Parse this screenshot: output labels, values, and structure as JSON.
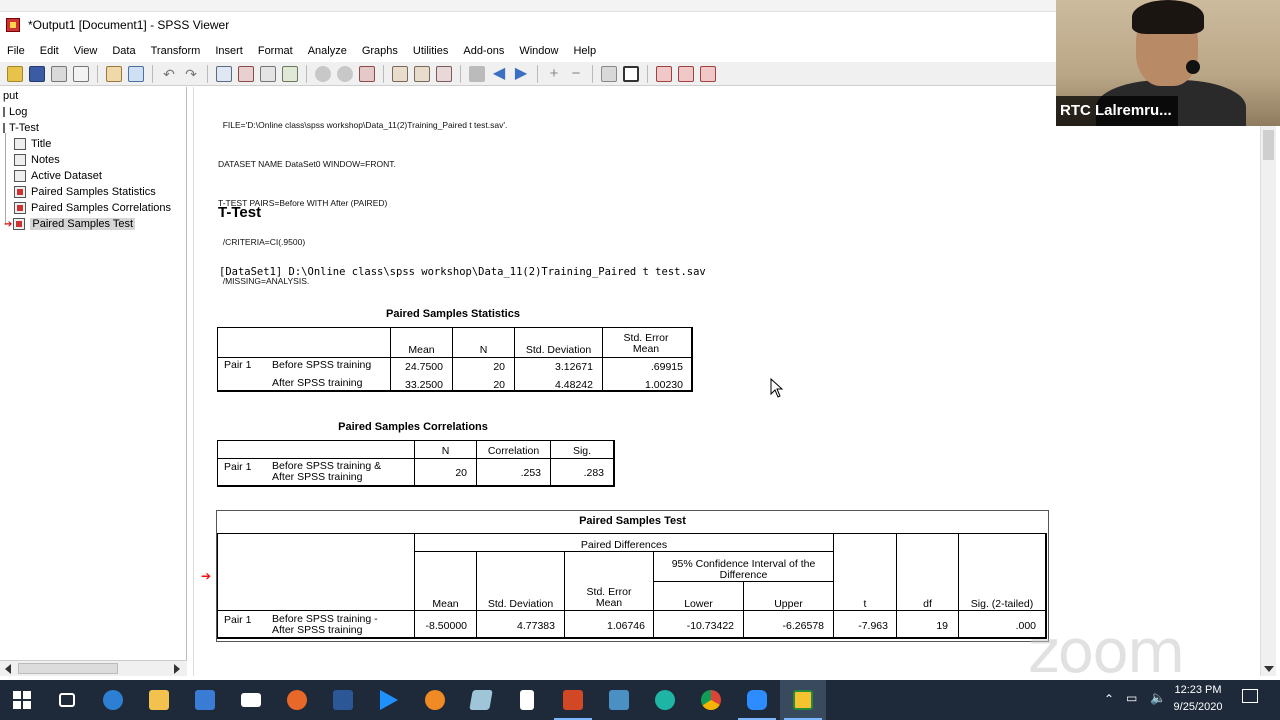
{
  "window": {
    "title": "*Output1 [Document1] - SPSS Viewer"
  },
  "menu": [
    "File",
    "Edit",
    "View",
    "Data",
    "Transform",
    "Insert",
    "Format",
    "Analyze",
    "Graphs",
    "Utilities",
    "Add-ons",
    "Window",
    "Help"
  ],
  "outline": {
    "root": "put",
    "log": "Log",
    "ttest": "T-Test",
    "children": [
      "Title",
      "Notes",
      "Active Dataset",
      "Paired Samples Statistics",
      "Paired Samples Correlations",
      "Paired Samples Test"
    ]
  },
  "syntax": {
    "lines": [
      "  FILE='D:\\Online class\\spss workshop\\Data_11(2)Training_Paired t test.sav'.",
      "DATASET NAME DataSet0 WINDOW=FRONT.",
      "T-TEST PAIRS=Before WITH After (PAIRED)",
      "  /CRITERIA=CI(.9500)",
      "  /MISSING=ANALYSIS."
    ]
  },
  "heading": "T-Test",
  "dataset_line": "[DataSet1] D:\\Online class\\spss workshop\\Data_11(2)Training_Paired t test.sav",
  "stats_table": {
    "title": "Paired Samples Statistics",
    "headers": {
      "mean": "Mean",
      "n": "N",
      "sd": "Std. Deviation",
      "sem": "Std. Error Mean"
    },
    "pair_label": "Pair 1",
    "rows": [
      {
        "label": "Before SPSS training",
        "mean": "24.7500",
        "n": "20",
        "sd": "3.12671",
        "sem": ".69915"
      },
      {
        "label": "After SPSS training",
        "mean": "33.2500",
        "n": "20",
        "sd": "4.48242",
        "sem": "1.00230"
      }
    ]
  },
  "corr_table": {
    "title": "Paired Samples Correlations",
    "headers": {
      "n": "N",
      "corr": "Correlation",
      "sig": "Sig."
    },
    "pair_label": "Pair 1",
    "row": {
      "label": "Before SPSS training & After SPSS training",
      "n": "20",
      "corr": ".253",
      "sig": ".283"
    }
  },
  "test_table": {
    "title": "Paired Samples Test",
    "group": "Paired Differences",
    "ci_group": "95% Confidence Interval of the Difference",
    "headers": {
      "mean": "Mean",
      "sd": "Std. Deviation",
      "sem": "Std. Error Mean",
      "lower": "Lower",
      "upper": "Upper",
      "t": "t",
      "df": "df",
      "sig": "Sig. (2-tailed)"
    },
    "pair_label": "Pair 1",
    "row": {
      "label": "Before SPSS training - After SPSS training",
      "mean": "-8.50000",
      "sd": "4.77383",
      "sem": "1.06746",
      "lower": "-10.73422",
      "upper": "-6.26578",
      "t": "-7.963",
      "df": "19",
      "sig": ".000"
    }
  },
  "zoom": {
    "participant": "RTC Lalremru...",
    "watermark": "zoom"
  },
  "taskbar": {
    "time": "12:23 PM",
    "date": "9/25/2020"
  }
}
